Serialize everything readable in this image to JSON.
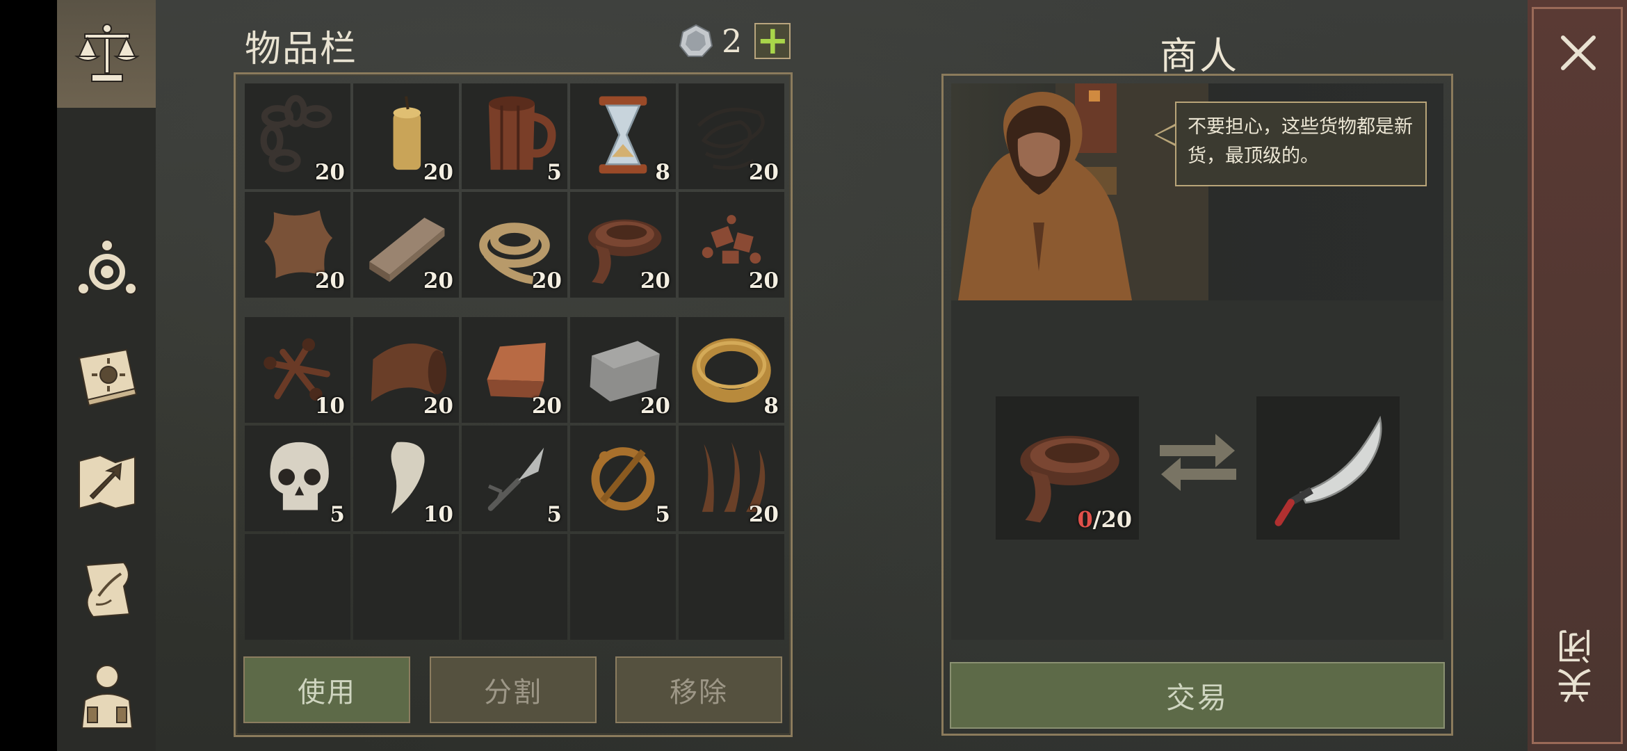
{
  "inventory": {
    "title": "物品栏",
    "currency": {
      "icon": "silver-coin-icon",
      "value": "2",
      "add_label": "+"
    },
    "top_grid": [
      {
        "name": "chain",
        "icon": "chain-icon",
        "qty": "20"
      },
      {
        "name": "candle",
        "icon": "candle-icon",
        "qty": "20"
      },
      {
        "name": "wooden-mug",
        "icon": "wooden-mug-icon",
        "qty": "5"
      },
      {
        "name": "hourglass",
        "icon": "hourglass-icon",
        "qty": "8"
      },
      {
        "name": "wire-coil",
        "icon": "wire-coil-icon",
        "qty": "20"
      },
      {
        "name": "hide",
        "icon": "hide-icon",
        "qty": "20"
      },
      {
        "name": "wood-plank",
        "icon": "wood-plank-icon",
        "qty": "20"
      },
      {
        "name": "rope",
        "icon": "rope-icon",
        "qty": "20"
      },
      {
        "name": "leather-strap",
        "icon": "leather-strap-icon",
        "qty": "20"
      },
      {
        "name": "scrap-parts",
        "icon": "scrap-parts-icon",
        "qty": "20"
      }
    ],
    "bottom_grid": [
      {
        "name": "nails",
        "icon": "nails-icon",
        "qty": "10"
      },
      {
        "name": "leather-roll",
        "icon": "leather-roll-icon",
        "qty": "20"
      },
      {
        "name": "copper-ingot",
        "icon": "copper-ingot-icon",
        "qty": "20"
      },
      {
        "name": "stone-block",
        "icon": "stone-block-icon",
        "qty": "20"
      },
      {
        "name": "gold-ring",
        "icon": "gold-ring-icon",
        "qty": "8"
      },
      {
        "name": "skull",
        "icon": "skull-icon",
        "qty": "5"
      },
      {
        "name": "fang",
        "icon": "fang-icon",
        "qty": "10"
      },
      {
        "name": "fork",
        "icon": "fork-icon",
        "qty": "5"
      },
      {
        "name": "brooch",
        "icon": "brooch-icon",
        "qty": "5"
      },
      {
        "name": "sinew",
        "icon": "sinew-icon",
        "qty": "20"
      },
      {
        "name": "empty",
        "icon": "",
        "qty": ""
      },
      {
        "name": "empty",
        "icon": "",
        "qty": ""
      },
      {
        "name": "empty",
        "icon": "",
        "qty": ""
      },
      {
        "name": "empty",
        "icon": "",
        "qty": ""
      },
      {
        "name": "empty",
        "icon": "",
        "qty": ""
      }
    ],
    "buttons": {
      "use": "使用",
      "split": "分割",
      "remove": "移除"
    }
  },
  "merchant": {
    "title": "商人",
    "speech": "不要担心，这些货物都是新货，最顶级的。",
    "give_item": {
      "icon": "leather-strap-icon",
      "have": "0",
      "need": "/20"
    },
    "receive_item": {
      "icon": "scimitar-icon"
    },
    "trade_label": "交易"
  },
  "close": {
    "label": "关闭"
  },
  "nav": [
    "scales-icon",
    "compass-icon",
    "sun-book-icon",
    "map-arrow-icon",
    "quest-scroll-icon",
    "character-icon"
  ],
  "colors": {
    "accent_green": "#a9d64a",
    "frame_gold": "#8b7b5c",
    "missing_red": "#e0504a"
  }
}
